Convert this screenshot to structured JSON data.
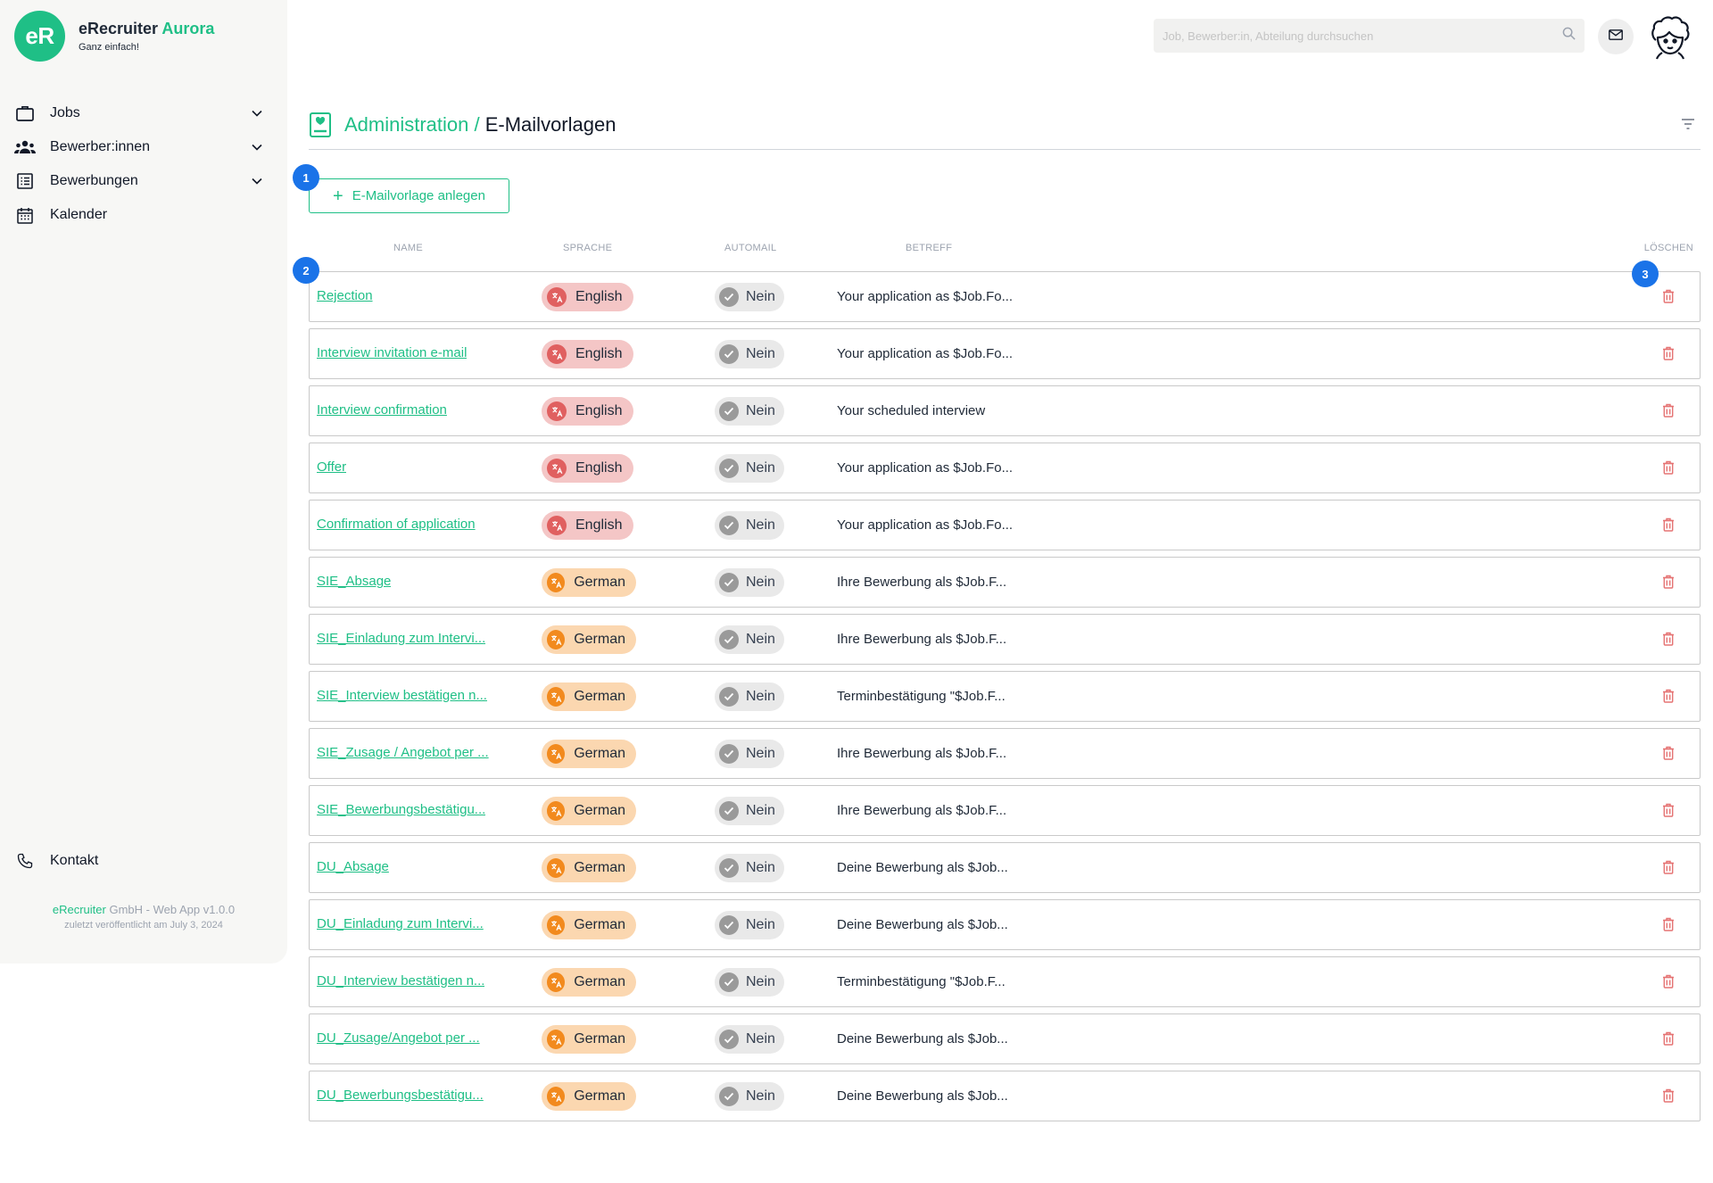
{
  "brand": {
    "logo": "eR",
    "name": "eRecruiter",
    "name_accent": "Aurora",
    "tagline": "Ganz einfach!"
  },
  "nav": [
    {
      "label": "Jobs",
      "icon": "briefcase-icon",
      "expandable": true
    },
    {
      "label": "Bewerber:innen",
      "icon": "people-icon",
      "expandable": true
    },
    {
      "label": "Bewerbungen",
      "icon": "list-icon",
      "expandable": true
    },
    {
      "label": "Kalender",
      "icon": "calendar-icon",
      "expandable": false
    }
  ],
  "contact": {
    "label": "Kontakt",
    "icon": "phone-icon"
  },
  "footer": {
    "company_accent": "eRecruiter",
    "company_rest": " GmbH - Web App v1.0.0",
    "published": "zuletzt veröffentlicht am July 3, 2024"
  },
  "search": {
    "placeholder": "Job, Bewerber:in, Abteilung durchsuchen",
    "value": ""
  },
  "header": {
    "crumb": "Administration / ",
    "title": "E-Mailvorlagen"
  },
  "badges": [
    "1",
    "2",
    "3"
  ],
  "add_button": {
    "label": "E-Mailvorlage anlegen"
  },
  "columns": {
    "name": "NAME",
    "language": "SPRACHE",
    "automail": "AUTOMAIL",
    "subject": "BETREFF",
    "delete": "LÖSCHEN"
  },
  "colors": {
    "accent": "#1fbf86",
    "english_bg": "#f4c6c6",
    "german_bg": "#fbd7b0",
    "badge": "#1a73e8",
    "delete": "#e57373"
  },
  "templates": [
    {
      "name": "Rejection",
      "language": "English",
      "automail": "Nein",
      "subject": "Your application as $Job.Fo..."
    },
    {
      "name": "Interview invitation e-mail",
      "language": "English",
      "automail": "Nein",
      "subject": "Your application as $Job.Fo..."
    },
    {
      "name": "Interview confirmation",
      "language": "English",
      "automail": "Nein",
      "subject": "Your scheduled interview"
    },
    {
      "name": "Offer",
      "language": "English",
      "automail": "Nein",
      "subject": "Your application as $Job.Fo..."
    },
    {
      "name": "Confirmation of application",
      "language": "English",
      "automail": "Nein",
      "subject": "Your application as $Job.Fo..."
    },
    {
      "name": "SIE_Absage",
      "language": "German",
      "automail": "Nein",
      "subject": "Ihre Bewerbung als $Job.F..."
    },
    {
      "name": "SIE_Einladung zum Intervi...",
      "language": "German",
      "automail": "Nein",
      "subject": "Ihre Bewerbung als $Job.F..."
    },
    {
      "name": "SIE_Interview bestätigen n...",
      "language": "German",
      "automail": "Nein",
      "subject": "Terminbestätigung \"$Job.F..."
    },
    {
      "name": "SIE_Zusage / Angebot per ...",
      "language": "German",
      "automail": "Nein",
      "subject": "Ihre Bewerbung als $Job.F..."
    },
    {
      "name": "SIE_Bewerbungsbestätigu...",
      "language": "German",
      "automail": "Nein",
      "subject": "Ihre Bewerbung als $Job.F..."
    },
    {
      "name": "DU_Absage",
      "language": "German",
      "automail": "Nein",
      "subject": "Deine Bewerbung als $Job..."
    },
    {
      "name": "DU_Einladung zum Intervi...",
      "language": "German",
      "automail": "Nein",
      "subject": "Deine Bewerbung als $Job..."
    },
    {
      "name": "DU_Interview bestätigen n...",
      "language": "German",
      "automail": "Nein",
      "subject": "Terminbestätigung \"$Job.F..."
    },
    {
      "name": "DU_Zusage/Angebot per ...",
      "language": "German",
      "automail": "Nein",
      "subject": "Deine Bewerbung als $Job..."
    },
    {
      "name": "DU_Bewerbungsbestätigu...",
      "language": "German",
      "automail": "Nein",
      "subject": "Deine Bewerbung als $Job..."
    }
  ]
}
